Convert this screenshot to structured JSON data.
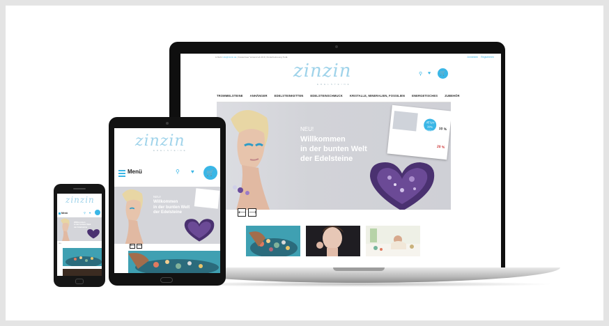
{
  "brand": {
    "logo": "zinzin",
    "tagline": "EDELSTEINE",
    "accent_color": "#3ab6e6"
  },
  "desktop": {
    "topbar": {
      "text_before": "& Mehr",
      "highlight": "info@zinzin.de",
      "text_after": "| Kostenloser Versand ab 49 € | Kinderbetreuung 5-HE",
      "login": "Anmelden",
      "register": "Registrieren"
    },
    "nav": [
      "TROMMELSTEINE",
      "ANHÄNGER",
      "EDELSTEINKETTEN",
      "EDELSTEINSCHMUCK",
      "KRISTALLE, MINERALIEN, FOSSILIEN",
      "ENERGETISCHES",
      "ZUBEHÖR"
    ],
    "hero": {
      "kicker": "NEU!",
      "title_line1": "Willkommen",
      "title_line2": "in der bunten Welt",
      "title_line3": "der Edelsteine",
      "card_badge": "JETZT 10% SPAREN",
      "card_percent": "10 %",
      "card_percent2": "20 %"
    },
    "prev_arrow": "⟵",
    "next_arrow": "⟶",
    "icons": [
      "search-icon",
      "heart-icon",
      "cart-icon"
    ]
  },
  "tablet": {
    "menu_label": "Menü",
    "hero_kicker": "NEU!",
    "hero_line1": "Willkommen",
    "hero_line2": "in der bunten Welt",
    "hero_line3": "der Edelsteine",
    "prev_arrow": "⟵",
    "next_arrow": "⟶"
  },
  "phone": {
    "menu_label": "Menü",
    "hero_line1": "Willkommen",
    "hero_line2": "in der bunten Welt",
    "hero_line3": "der Edelsteine",
    "small_text": "NEU"
  }
}
